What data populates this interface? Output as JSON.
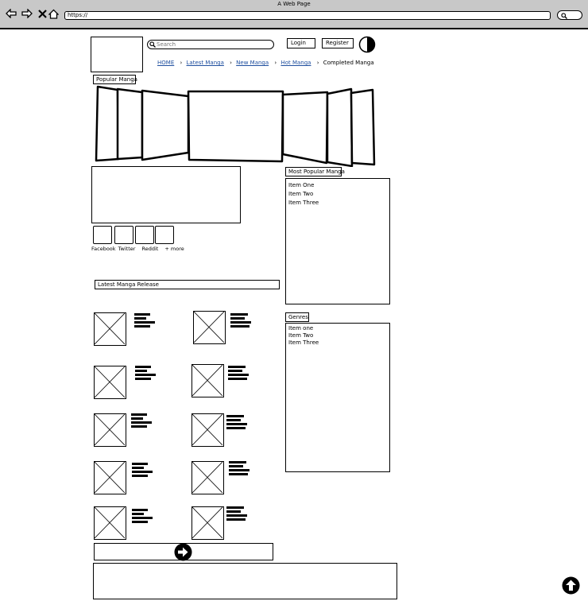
{
  "window": {
    "title": "A Web Page",
    "url": "https://"
  },
  "header": {
    "search_placeholder": "Search",
    "login_label": "Login",
    "register_label": "Register"
  },
  "breadcrumb": {
    "links": [
      "HOME",
      "Latest Manga",
      "New Manga",
      "Hot Manga"
    ],
    "current": "Completed Manga"
  },
  "popular": {
    "label": "Popular Manga"
  },
  "share": {
    "labels": [
      "Facebook",
      "Twitter",
      "Reddit",
      "+ more"
    ]
  },
  "latest": {
    "label": "Latest Manga Release"
  },
  "most_popular": {
    "label": "Most Popular Manga",
    "items": [
      "Item One",
      "Item Two",
      "Item Three"
    ]
  },
  "genres": {
    "label": "Genres",
    "items": [
      "Item one",
      "Item Two",
      "Item Three"
    ]
  }
}
